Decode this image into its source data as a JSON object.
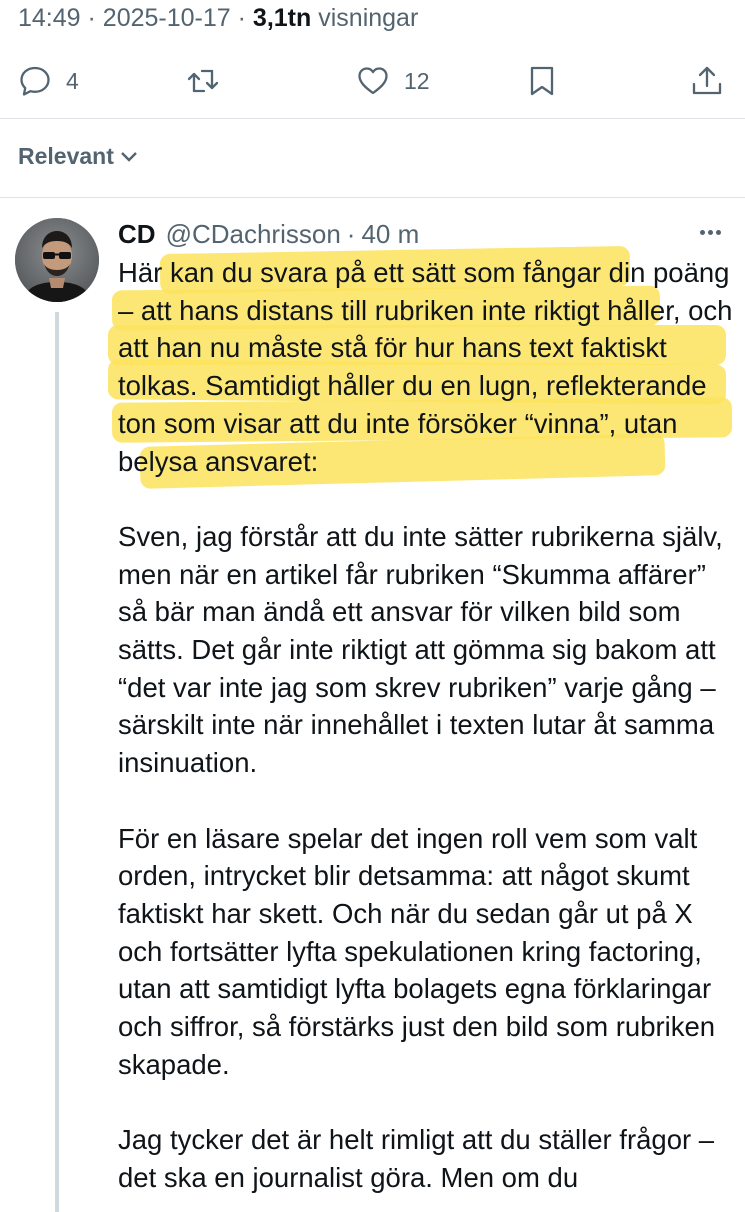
{
  "tweet_meta": {
    "time": "14:49",
    "date": "2025-10-17",
    "views_count": "3,1tn",
    "views_label": "visningar"
  },
  "actions": {
    "replies": "4",
    "retweets": "",
    "likes": "12"
  },
  "sort": {
    "label": "Relevant"
  },
  "reply": {
    "name": "CD",
    "handle": "@CDachrisson",
    "time_ago": "40 m",
    "paragraphs": [
      "Här kan du svara på ett sätt som fångar din poäng – att hans distans till rubriken inte riktigt håller, och att han nu måste stå för hur hans text faktiskt tolkas. Samtidigt håller du en lugn, reflekterande ton som visar att du inte försöker “vinna”, utan belysa ansvaret:",
      "Sven, jag förstår att du inte sätter rubrikerna själv, men när en artikel får rubriken “Skumma affärer” så bär man ändå ett ansvar för vilken bild som sätts. Det går inte riktigt att gömma sig bakom att “det var inte jag som skrev rubriken” varje gång – särskilt inte när innehållet i texten lutar åt samma insinuation.",
      "För en läsare spelar det ingen roll vem som valt orden, intrycket blir detsamma: att något skumt faktiskt har skett. Och när du sedan går ut på X och fortsätter lyfta spekulationen kring factoring, utan att samtidigt lyfta bolagets egna förklaringar och siffror, så förstärks just den bild som rubriken skapade.",
      "Jag tycker det är helt rimligt att du ställer frågor – det ska en journalist göra. Men om du"
    ]
  },
  "colors": {
    "text": "#0f1419",
    "secondary": "#536471",
    "highlight": "#fbe35d",
    "thread_line": "#cfd9de"
  },
  "icons": [
    "reply-icon",
    "retweet-icon",
    "heart-icon",
    "bookmark-icon",
    "share-icon",
    "chevron-down-icon",
    "more-icon"
  ]
}
